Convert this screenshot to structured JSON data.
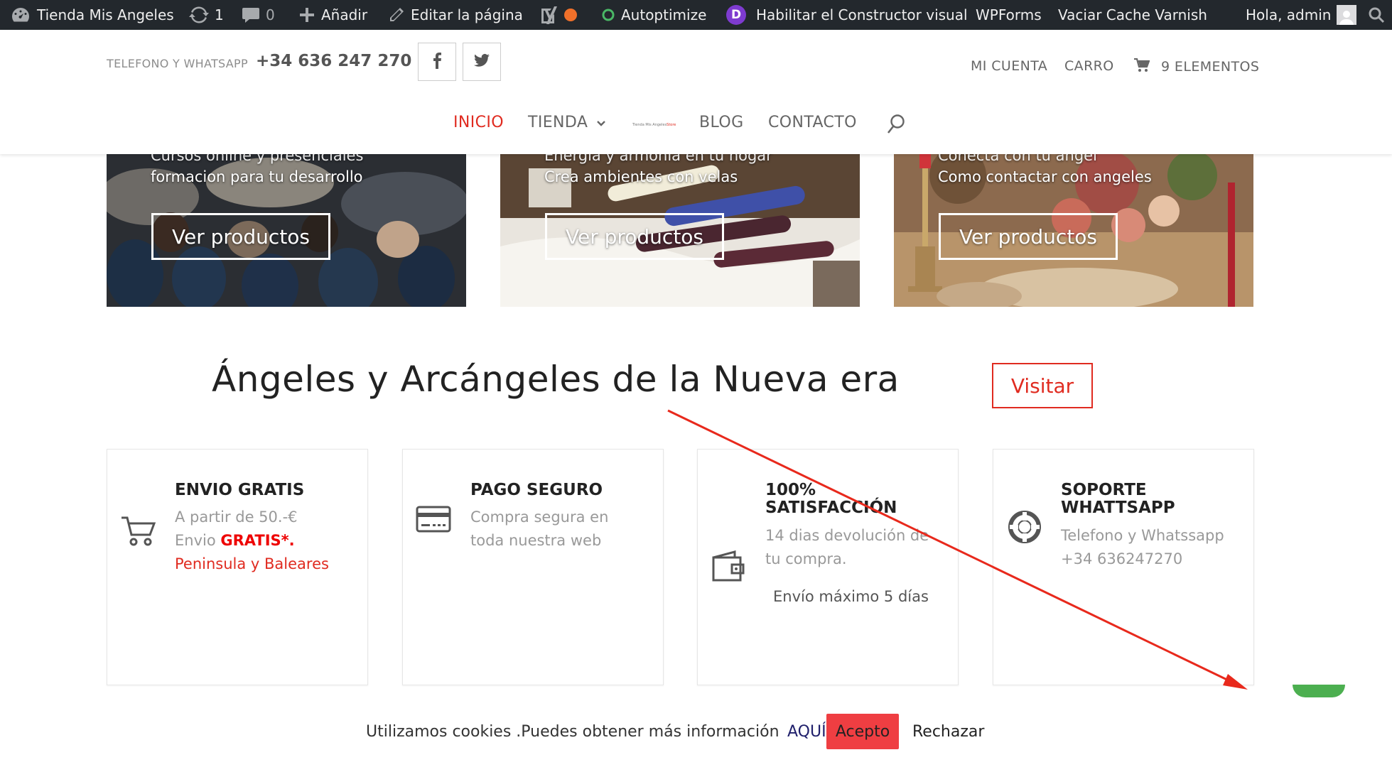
{
  "admin_bar": {
    "site_name": "Tienda Mis Angeles",
    "updates_count": "1",
    "comments_count": "0",
    "add_label": "Añadir",
    "edit_page_label": "Editar la página",
    "autoptimize_label": "Autoptimize",
    "divi_icon_letter": "D",
    "visual_builder_label": "Habilitar el Constructor visual",
    "wpforms_label": "WPForms",
    "varnish_label": "Vaciar Cache Varnish",
    "greeting": "Hola, admin",
    "icons": [
      "dashboard-icon",
      "update-icon",
      "comment-icon",
      "plus-icon",
      "pencil-icon",
      "yoast-icon",
      "status-dot",
      "autoptimize-icon",
      "divi-icon",
      "avatar",
      "search-icon"
    ],
    "colors": {
      "bar_bg": "#23282d",
      "seo_dot": "#f0702a",
      "autoptimize_ring": "#4ab866",
      "divi": "#7e3bd0"
    }
  },
  "header": {
    "phone_label": "TELEFONO Y WHATSAPP",
    "phone_number": "+34 636 247 270",
    "account_label": "MI CUENTA",
    "cart_label": "CARRO",
    "cart_items": "9 ELEMENTOS",
    "icons": [
      "facebook-icon",
      "twitter-icon",
      "cart-icon"
    ]
  },
  "menu": {
    "items": [
      {
        "label": "INICIO",
        "active": true
      },
      {
        "label": "TIENDA",
        "active": false
      },
      {
        "label": "BLOG",
        "active": false
      },
      {
        "label": "CONTACTO",
        "active": false
      }
    ],
    "logo_text": "Tienda Mis Angeles",
    "logo_accent": "Store",
    "accent_color": "#e02b20",
    "icons": [
      "chevron-down-icon",
      "search-icon"
    ]
  },
  "banners": [
    {
      "top_text": "Cursos online y presenciales",
      "caption": "formacion para tu desarrollo",
      "button": "Ver productos"
    },
    {
      "top_text": "Energia y armonia en tu hogar",
      "caption": "Crea ambientes con velas",
      "button": "Ver productos"
    },
    {
      "top_text": "Conecta con tu angel",
      "caption": "Como contactar con angeles",
      "button": "Ver productos"
    }
  ],
  "headline": {
    "title": "Ángeles y Arcángeles de la Nueva era",
    "visit_button": "Visitar"
  },
  "features": [
    {
      "title": "ENVIO GRATIS",
      "line1": "A partir de  50.-€",
      "line2_prefix": "Envio ",
      "line2_bold": "GRATIS*.",
      "line3": "Peninsula y Baleares",
      "icon": "cart-icon"
    },
    {
      "title": "PAGO SEGURO",
      "line1": "Compra segura en",
      "line2": "toda nuestra web",
      "icon": "credit-card-icon"
    },
    {
      "title": "100% SATISFACCIÓN",
      "line1": "14 dias devolución de",
      "line2": "tu compra.",
      "extra": "Envío máximo 5 días",
      "icon": "wallet-icon"
    },
    {
      "title": "SOPORTE WHATTSAPP",
      "line1": "Telefono y Whatssapp",
      "line2": "+34 636247270",
      "icon": "lifebuoy-icon"
    }
  ],
  "cookie_bar": {
    "message": "Utilizamos cookies .Puedes obtener más información",
    "link": "AQUÍ",
    "accept": "Acepto",
    "reject": "Rechazar",
    "accept_color": "#ef3e42"
  },
  "annotation": {
    "type": "arrow",
    "color": "#e8291c"
  }
}
